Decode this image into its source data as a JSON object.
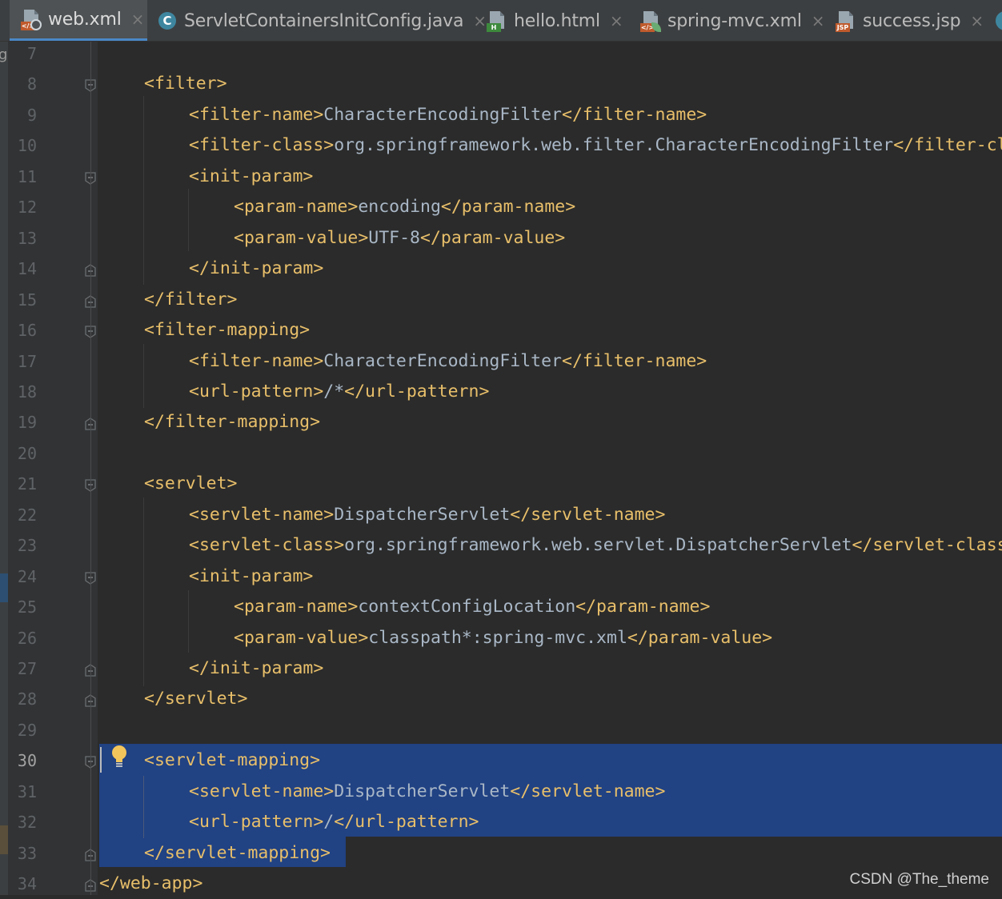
{
  "tabs": [
    {
      "label": "web.xml",
      "icon": "xml-file-icon",
      "active": true
    },
    {
      "label": "ServletContainersInitConfig.java",
      "icon": "java-class-icon",
      "active": false
    },
    {
      "label": "hello.html",
      "icon": "html-file-icon",
      "active": false
    },
    {
      "label": "spring-mvc.xml",
      "icon": "spring-xml-file-icon",
      "active": false
    },
    {
      "label": "success.jsp",
      "icon": "jsp-file-icon",
      "active": false
    }
  ],
  "close_glyph": "×",
  "left_strip_glyph": "g",
  "icon_badges": {
    "xml": "</>",
    "java": "C",
    "html": "H",
    "jsp": "JSP"
  },
  "editor": {
    "current_line": 30,
    "lines": [
      {
        "num": "7",
        "indent": 0,
        "tokens": []
      },
      {
        "num": "8",
        "indent": 1,
        "tokens": [
          {
            "t": "tag",
            "v": "<filter>"
          }
        ]
      },
      {
        "num": "9",
        "indent": 2,
        "tokens": [
          {
            "t": "tag",
            "v": "<filter-name>"
          },
          {
            "t": "txt",
            "v": "CharacterEncodingFilter"
          },
          {
            "t": "tag",
            "v": "</filter-name>"
          }
        ]
      },
      {
        "num": "10",
        "indent": 2,
        "tokens": [
          {
            "t": "tag",
            "v": "<filter-class>"
          },
          {
            "t": "txt",
            "v": "org.springframework.web.filter.CharacterEncodingFilter"
          },
          {
            "t": "tag",
            "v": "</filter-class>"
          }
        ]
      },
      {
        "num": "11",
        "indent": 2,
        "tokens": [
          {
            "t": "tag",
            "v": "<init-param>"
          }
        ]
      },
      {
        "num": "12",
        "indent": 3,
        "tokens": [
          {
            "t": "tag",
            "v": "<param-name>"
          },
          {
            "t": "txt",
            "v": "encoding"
          },
          {
            "t": "tag",
            "v": "</param-name>"
          }
        ]
      },
      {
        "num": "13",
        "indent": 3,
        "tokens": [
          {
            "t": "tag",
            "v": "<param-value>"
          },
          {
            "t": "txt",
            "v": "UTF-8"
          },
          {
            "t": "tag",
            "v": "</param-value>"
          }
        ]
      },
      {
        "num": "14",
        "indent": 2,
        "tokens": [
          {
            "t": "tag",
            "v": "</init-param>"
          }
        ]
      },
      {
        "num": "15",
        "indent": 1,
        "tokens": [
          {
            "t": "tag",
            "v": "</filter>"
          }
        ]
      },
      {
        "num": "16",
        "indent": 1,
        "tokens": [
          {
            "t": "tag",
            "v": "<filter-mapping>"
          }
        ]
      },
      {
        "num": "17",
        "indent": 2,
        "tokens": [
          {
            "t": "tag",
            "v": "<filter-name>"
          },
          {
            "t": "txt",
            "v": "CharacterEncodingFilter"
          },
          {
            "t": "tag",
            "v": "</filter-name>"
          }
        ]
      },
      {
        "num": "18",
        "indent": 2,
        "tokens": [
          {
            "t": "tag",
            "v": "<url-pattern>"
          },
          {
            "t": "txt",
            "v": "/*"
          },
          {
            "t": "tag",
            "v": "</url-pattern>"
          }
        ]
      },
      {
        "num": "19",
        "indent": 1,
        "tokens": [
          {
            "t": "tag",
            "v": "</filter-mapping>"
          }
        ]
      },
      {
        "num": "20",
        "indent": 0,
        "tokens": []
      },
      {
        "num": "21",
        "indent": 1,
        "tokens": [
          {
            "t": "tag",
            "v": "<servlet>"
          }
        ]
      },
      {
        "num": "22",
        "indent": 2,
        "tokens": [
          {
            "t": "tag",
            "v": "<servlet-name>"
          },
          {
            "t": "txt",
            "v": "DispatcherServlet"
          },
          {
            "t": "tag",
            "v": "</servlet-name>"
          }
        ]
      },
      {
        "num": "23",
        "indent": 2,
        "tokens": [
          {
            "t": "tag",
            "v": "<servlet-class>"
          },
          {
            "t": "txt",
            "v": "org.springframework.web.servlet.DispatcherServlet"
          },
          {
            "t": "tag",
            "v": "</servlet-class>"
          }
        ]
      },
      {
        "num": "24",
        "indent": 2,
        "tokens": [
          {
            "t": "tag",
            "v": "<init-param>"
          }
        ]
      },
      {
        "num": "25",
        "indent": 3,
        "tokens": [
          {
            "t": "tag",
            "v": "<param-name>"
          },
          {
            "t": "txt",
            "v": "contextConfigLocation"
          },
          {
            "t": "tag",
            "v": "</param-name>"
          }
        ]
      },
      {
        "num": "26",
        "indent": 3,
        "tokens": [
          {
            "t": "tag",
            "v": "<param-value>"
          },
          {
            "t": "txt",
            "v": "classpath*:spring-mvc.xml"
          },
          {
            "t": "tag",
            "v": "</param-value>"
          }
        ]
      },
      {
        "num": "27",
        "indent": 2,
        "tokens": [
          {
            "t": "tag",
            "v": "</init-param>"
          }
        ]
      },
      {
        "num": "28",
        "indent": 1,
        "tokens": [
          {
            "t": "tag",
            "v": "</servlet>"
          }
        ]
      },
      {
        "num": "29",
        "indent": 0,
        "tokens": []
      },
      {
        "num": "30",
        "indent": 1,
        "tokens": [
          {
            "t": "tag",
            "v": "<servlet-mapping>"
          }
        ]
      },
      {
        "num": "31",
        "indent": 2,
        "tokens": [
          {
            "t": "tag",
            "v": "<servlet-name>"
          },
          {
            "t": "txt",
            "v": "DispatcherServlet"
          },
          {
            "t": "tag",
            "v": "</servlet-name>"
          }
        ]
      },
      {
        "num": "32",
        "indent": 2,
        "tokens": [
          {
            "t": "tag",
            "v": "<url-pattern>"
          },
          {
            "t": "txt",
            "v": "/"
          },
          {
            "t": "tag",
            "v": "</url-pattern>"
          }
        ]
      },
      {
        "num": "33",
        "indent": 1,
        "tokens": [
          {
            "t": "tag",
            "v": "</servlet-mapping>"
          }
        ]
      },
      {
        "num": "34",
        "indent": 0,
        "tokens": [
          {
            "t": "tag",
            "v": "</web-app>"
          }
        ]
      }
    ]
  },
  "watermark": "CSDN @The_theme",
  "colors": {
    "background": "#2b2b2b",
    "gutter": "#313335",
    "tag": "#e8bf6a",
    "text": "#a9b7c6",
    "selection": "#214283",
    "active_tab_underline": "#4a88c7"
  }
}
